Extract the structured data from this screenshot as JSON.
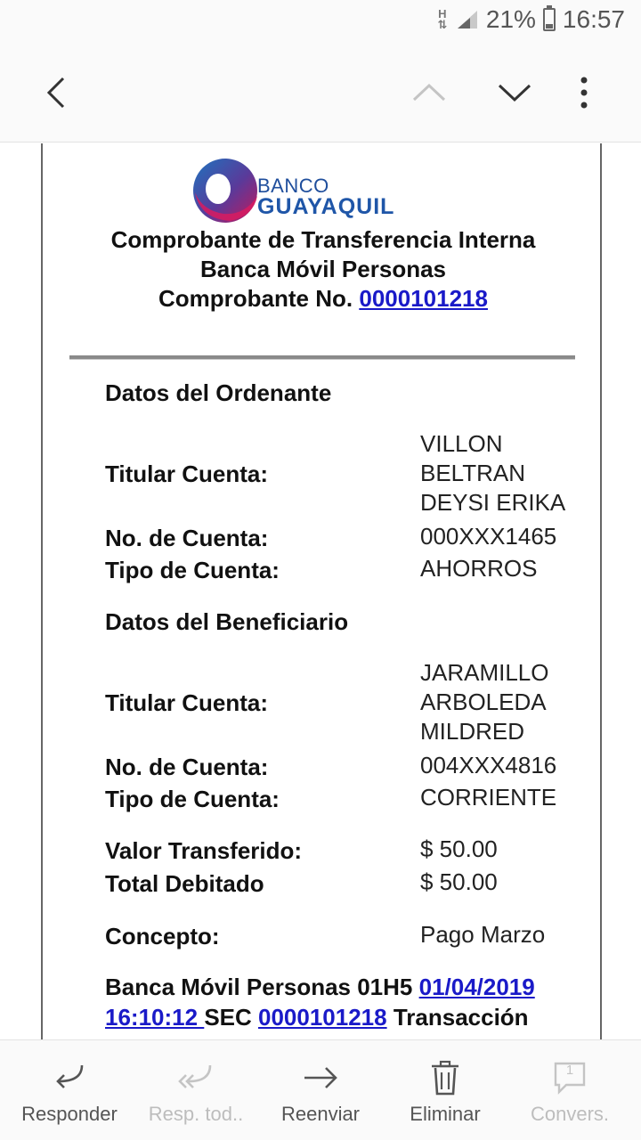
{
  "status_bar": {
    "network": "H",
    "battery": "21%",
    "battery_level": 0.21,
    "time": "16:57"
  },
  "app_bar": {
    "back_icon": "back-arrow-icon",
    "prev_icon": "chevron-up-icon",
    "next_icon": "chevron-down-icon",
    "menu_icon": "more-vertical-icon"
  },
  "email": {
    "logo": {
      "line1": "BANCO",
      "line2": "GUAYAQUIL"
    },
    "header": {
      "title": "Comprobante de Transferencia Interna",
      "subtitle": "Banca Móvil Personas",
      "receipt_label": "Comprobante No.",
      "receipt_number": "0000101218"
    },
    "ordenante": {
      "section_title": "Datos del Ordenante",
      "titular_label": "Titular Cuenta:",
      "titular_lines": [
        "VILLON",
        "BELTRAN",
        "DEYSI ERIKA"
      ],
      "cuenta_label": "No. de Cuenta:",
      "cuenta_value": "000XXX1465",
      "tipo_label": "Tipo de Cuenta:",
      "tipo_value": "AHORROS"
    },
    "beneficiario": {
      "section_title": "Datos del Beneficiario",
      "titular_label": "Titular Cuenta:",
      "titular_lines": [
        "JARAMILLO",
        "ARBOLEDA",
        "MILDRED"
      ],
      "cuenta_label": "No. de Cuenta:",
      "cuenta_value": "004XXX4816",
      "tipo_label": "Tipo de Cuenta:",
      "tipo_value": "CORRIENTE"
    },
    "valor_label": "Valor Transferido:",
    "valor_value": "$ 50.00",
    "total_label": "Total Debitado",
    "total_value": "$ 50.00",
    "concepto_label": "Concepto:",
    "concepto_value": "Pago Marzo",
    "footer": {
      "prefix": "Banca Móvil Personas 01H5 ",
      "date": "01/04/2019",
      "time": "16:10:12 ",
      "sec_label": "SEC ",
      "sec_number": "0000101218",
      "suffix": " Transacción"
    }
  },
  "bottom_bar": {
    "reply": "Responder",
    "reply_all": "Resp. tod..",
    "forward": "Reenviar",
    "delete": "Eliminar",
    "conversation": "Convers.",
    "conversation_count": "1"
  },
  "colors": {
    "link": "#1a1ac8",
    "logo_blue": "#1f56a8",
    "logo_magenta": "#c2185b"
  }
}
